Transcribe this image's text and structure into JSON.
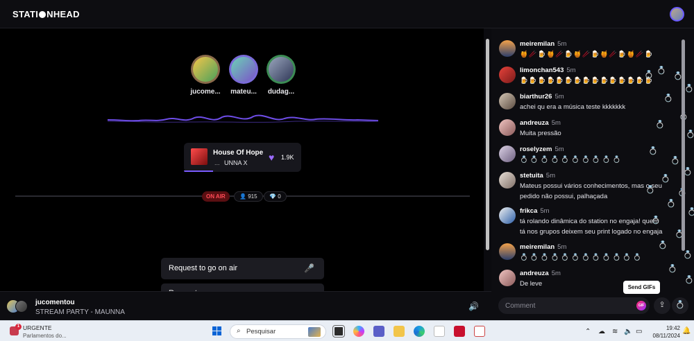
{
  "header": {
    "logo": "STATIONHEAD"
  },
  "hosts": [
    {
      "name": "jucome...",
      "ring": "#8a6a4a",
      "pic": "linear-gradient(135deg,#f5c64a,#49a05b)"
    },
    {
      "name": "mateu...",
      "ring": "#7a6bd8",
      "pic": "linear-gradient(135deg,#6bd3b5,#7b52c9)"
    },
    {
      "name": "dudag...",
      "ring": "#3c8c54",
      "pic": "linear-gradient(135deg,#9aa6bd,#2e3656)"
    }
  ],
  "now_playing": {
    "title": "House Of Hope",
    "dots": "...",
    "artist": "UNNA X",
    "likes": "1.9K",
    "progress_pct": 25
  },
  "stats": {
    "on_air": "ON AIR",
    "listeners": "915",
    "gems": "0"
  },
  "request": {
    "label": "Request to go on air",
    "ghost_label": "Request"
  },
  "player": {
    "user": "jucomentou",
    "status": "STREAM PARTY - MAUNNA"
  },
  "chat": {
    "messages": [
      {
        "user": "meiremilan",
        "time": "5m",
        "text": "🍯🥢🍺🍯🥢🍺🍯🥢🍺🍯🥢🍺🍯🥢🍺",
        "style": "emoji",
        "av": "linear-gradient(180deg,#f2a14a,#2d3f6b)"
      },
      {
        "user": "limonchan543",
        "time": "5m",
        "text": "🍺🍺🍺🍺🍺🍺🍺🍺🍺🍺🍺🍺🍺🍺🍺",
        "style": "emoji",
        "av": "linear-gradient(135deg,#e8433b,#7a1a1a)"
      },
      {
        "user": "biarthur26",
        "time": "5m",
        "text": "achei qu era a música teste kkkkkkk",
        "style": "text",
        "av": "linear-gradient(135deg,#d5c7b6,#5b4c41)"
      },
      {
        "user": "andreuza",
        "time": "5m",
        "text": "Muita pressão",
        "style": "text",
        "av": "linear-gradient(135deg,#f1c5c2,#8a5a5a)"
      },
      {
        "user": "roselyzem",
        "time": "5m",
        "text": "💍💍💍💍💍💍💍💍💍💍",
        "style": "ring",
        "av": "linear-gradient(135deg,#dcd2e6,#6e6080)"
      },
      {
        "user": "stetuita",
        "time": "5m",
        "text": "Mateus possui vários conhecimentos, mas o seu pedido não possui, palhaçada",
        "style": "text",
        "av": "linear-gradient(135deg,#e9e0d8,#7f6e66)"
      },
      {
        "user": "frikca",
        "time": "5m",
        "text": "tá rolando dinâmica do station no engaja! quem tá nos grupos deixem seu print logado no engaja",
        "style": "text",
        "av": "linear-gradient(135deg,#f0f0f0,#2c5fa8)"
      },
      {
        "user": "meiremilan",
        "time": "5m",
        "text": "💍💍💍💍💍💍💍💍💍💍💍💍",
        "style": "ring",
        "av": "linear-gradient(180deg,#f2a14a,#2d3f6b)"
      },
      {
        "user": "andreuza",
        "time": "5m",
        "text": "De leve",
        "style": "text",
        "av": "linear-gradient(135deg,#f1c5c2,#8a5a5a)"
      }
    ],
    "send_gifs_tooltip": "Send GIFs",
    "comment_placeholder": "Comment",
    "gif_label": "GIF"
  },
  "taskbar": {
    "notice_count": "1",
    "notice_title": "URGENTE",
    "notice_subtitle": "Parlamentos do...",
    "search_placeholder": "Pesquisar",
    "time": "19:42",
    "date": "08/11/2024"
  }
}
